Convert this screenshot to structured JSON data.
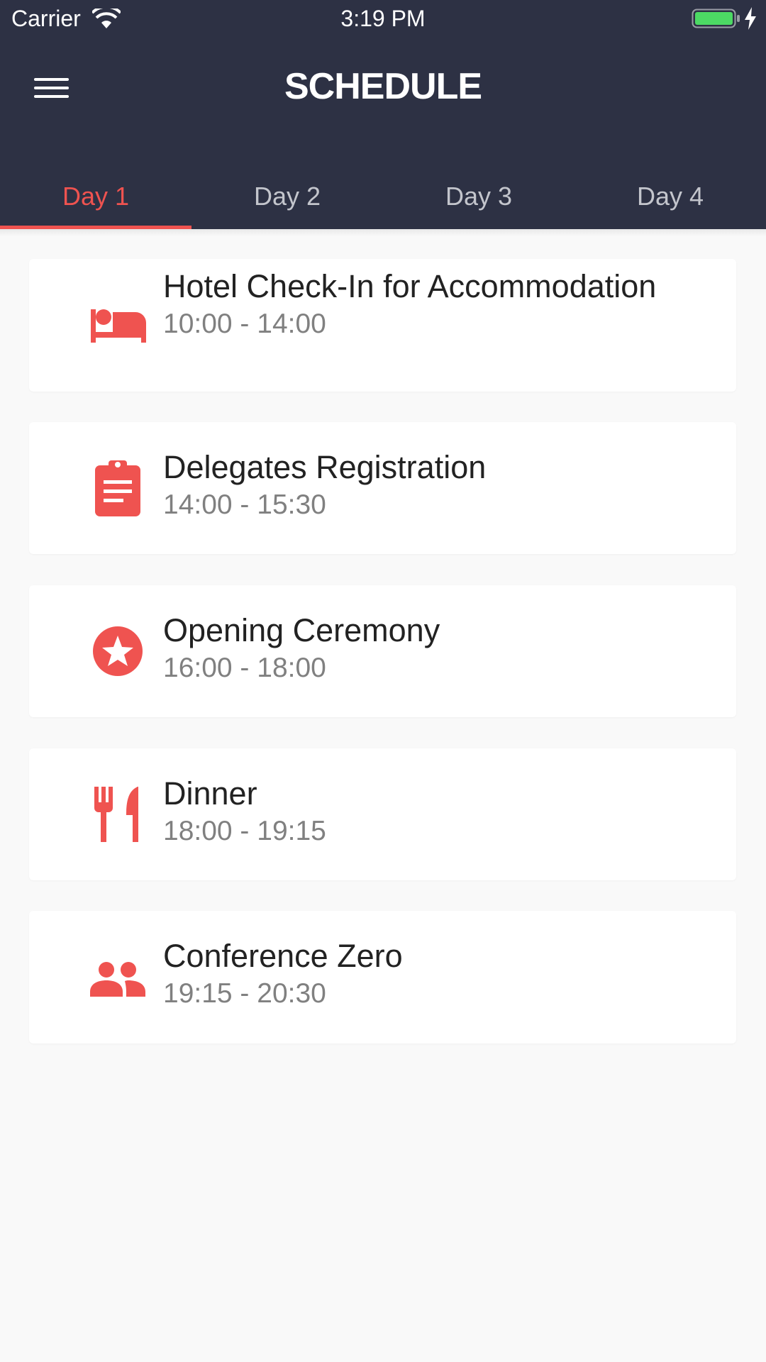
{
  "status_bar": {
    "carrier": "Carrier",
    "time": "3:19 PM",
    "battery_color": "#4cd964"
  },
  "header": {
    "title": "SCHEDULE",
    "background": "#2d3144"
  },
  "tabs": [
    {
      "label": "Day 1",
      "active": true
    },
    {
      "label": "Day 2",
      "active": false
    },
    {
      "label": "Day 3",
      "active": false
    },
    {
      "label": "Day 4",
      "active": false
    }
  ],
  "accent_color": "#ef5350",
  "events": [
    {
      "icon": "bed-icon",
      "title": "Hotel Check-In for Accommodation",
      "time": "10:00 - 14:00"
    },
    {
      "icon": "clipboard-icon",
      "title": "Delegates Registration",
      "time": "14:00 - 15:30"
    },
    {
      "icon": "star-circle-icon",
      "title": "Opening Ceremony",
      "time": "16:00 - 18:00"
    },
    {
      "icon": "restaurant-icon",
      "title": "Dinner",
      "time": "18:00 - 19:15"
    },
    {
      "icon": "people-icon",
      "title": "Conference Zero",
      "time": "19:15 - 20:30"
    }
  ]
}
